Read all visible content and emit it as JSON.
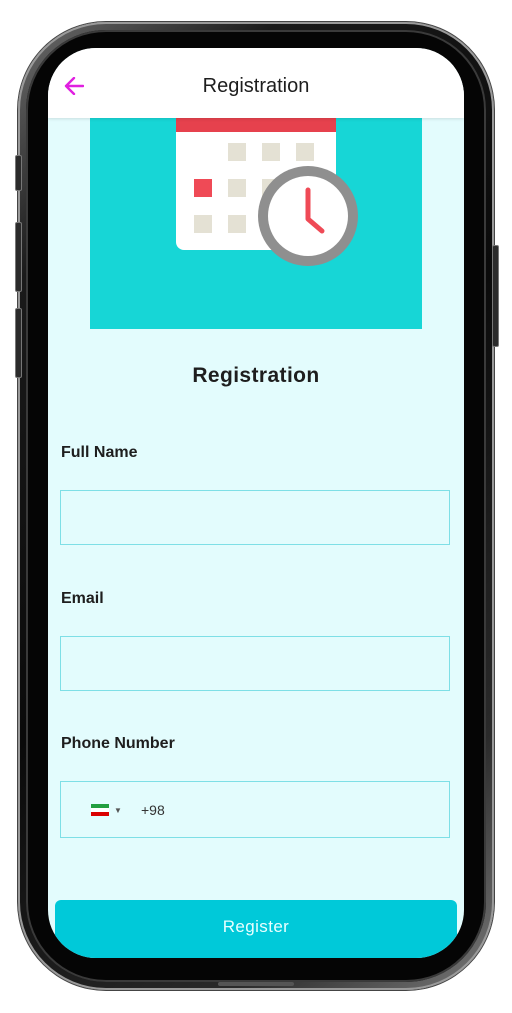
{
  "appbar": {
    "title": "Registration",
    "back_icon": "arrow-left-icon",
    "accent_color": "#e020e0"
  },
  "hero": {
    "icon": "calendar-clock-illustration",
    "background": "#17d6d6"
  },
  "form": {
    "title": "Registration",
    "full_name": {
      "label": "Full Name",
      "value": ""
    },
    "email": {
      "label": "Email",
      "value": ""
    },
    "phone": {
      "label": "Phone Number",
      "country_flag": "iran-flag-icon",
      "dial_code": "+98",
      "value": ""
    }
  },
  "register_button": {
    "label": "Register",
    "color": "#00c9d9"
  },
  "colors": {
    "screen_background": "#e3fcfd",
    "input_border": "#7edfe6"
  }
}
